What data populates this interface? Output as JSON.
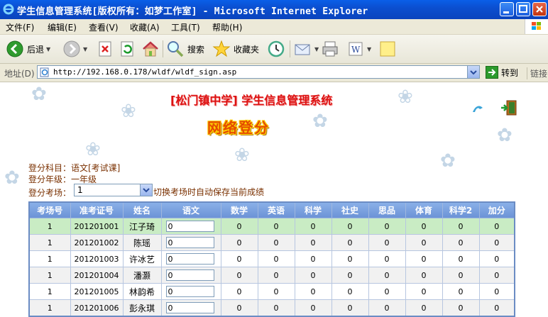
{
  "window": {
    "title": "学生信息管理系统[版权所有：如梦工作室] - Microsoft Internet Explorer"
  },
  "menu": [
    "文件(F)",
    "编辑(E)",
    "查看(V)",
    "收藏(A)",
    "工具(T)",
    "帮助(H)"
  ],
  "toolbar": {
    "back": "后退",
    "search": "搜索",
    "favorites": "收藏夹"
  },
  "address": {
    "label": "地址(D)",
    "url": "http://192.168.0.178/wldf/wldf_sign.asp",
    "go": "转到",
    "links": "链接"
  },
  "page": {
    "system_title": "[松门镇中学] 学生信息管理系统",
    "heading": "网络登分",
    "subject_line": "登分科目：语文[考试课]",
    "grade_line": "登分年级：一年级",
    "room_label": "登分考场：",
    "room_value": "1",
    "room_hint": "切换考场时自动保存当前成绩"
  },
  "table": {
    "headers": [
      "考场号",
      "准考证号",
      "姓名",
      "语文",
      "数学",
      "英语",
      "科学",
      "社史",
      "思品",
      "体育",
      "科学2",
      "加分"
    ],
    "rows": [
      {
        "room": "1",
        "id": "201201001",
        "name": "江子琦",
        "chinese": "0",
        "scores": [
          "0",
          "0",
          "0",
          "0",
          "0",
          "0",
          "0",
          "0"
        ]
      },
      {
        "room": "1",
        "id": "201201002",
        "name": "陈瑶",
        "chinese": "0",
        "scores": [
          "0",
          "0",
          "0",
          "0",
          "0",
          "0",
          "0",
          "0"
        ]
      },
      {
        "room": "1",
        "id": "201201003",
        "name": "许冰艺",
        "chinese": "0",
        "scores": [
          "0",
          "0",
          "0",
          "0",
          "0",
          "0",
          "0",
          "0"
        ]
      },
      {
        "room": "1",
        "id": "201201004",
        "name": "潘灏",
        "chinese": "0",
        "scores": [
          "0",
          "0",
          "0",
          "0",
          "0",
          "0",
          "0",
          "0"
        ]
      },
      {
        "room": "1",
        "id": "201201005",
        "name": "林韵希",
        "chinese": "0",
        "scores": [
          "0",
          "0",
          "0",
          "0",
          "0",
          "0",
          "0",
          "0"
        ]
      },
      {
        "room": "1",
        "id": "201201006",
        "name": "彭永琪",
        "chinese": "0",
        "scores": [
          "0",
          "0",
          "0",
          "0",
          "0",
          "0",
          "0",
          "0"
        ]
      }
    ]
  },
  "colors": {
    "titlebar": "#0b4fd0",
    "header": "#6c93d6",
    "selected_row": "#c9ecc4",
    "heading": "#e44b00"
  }
}
